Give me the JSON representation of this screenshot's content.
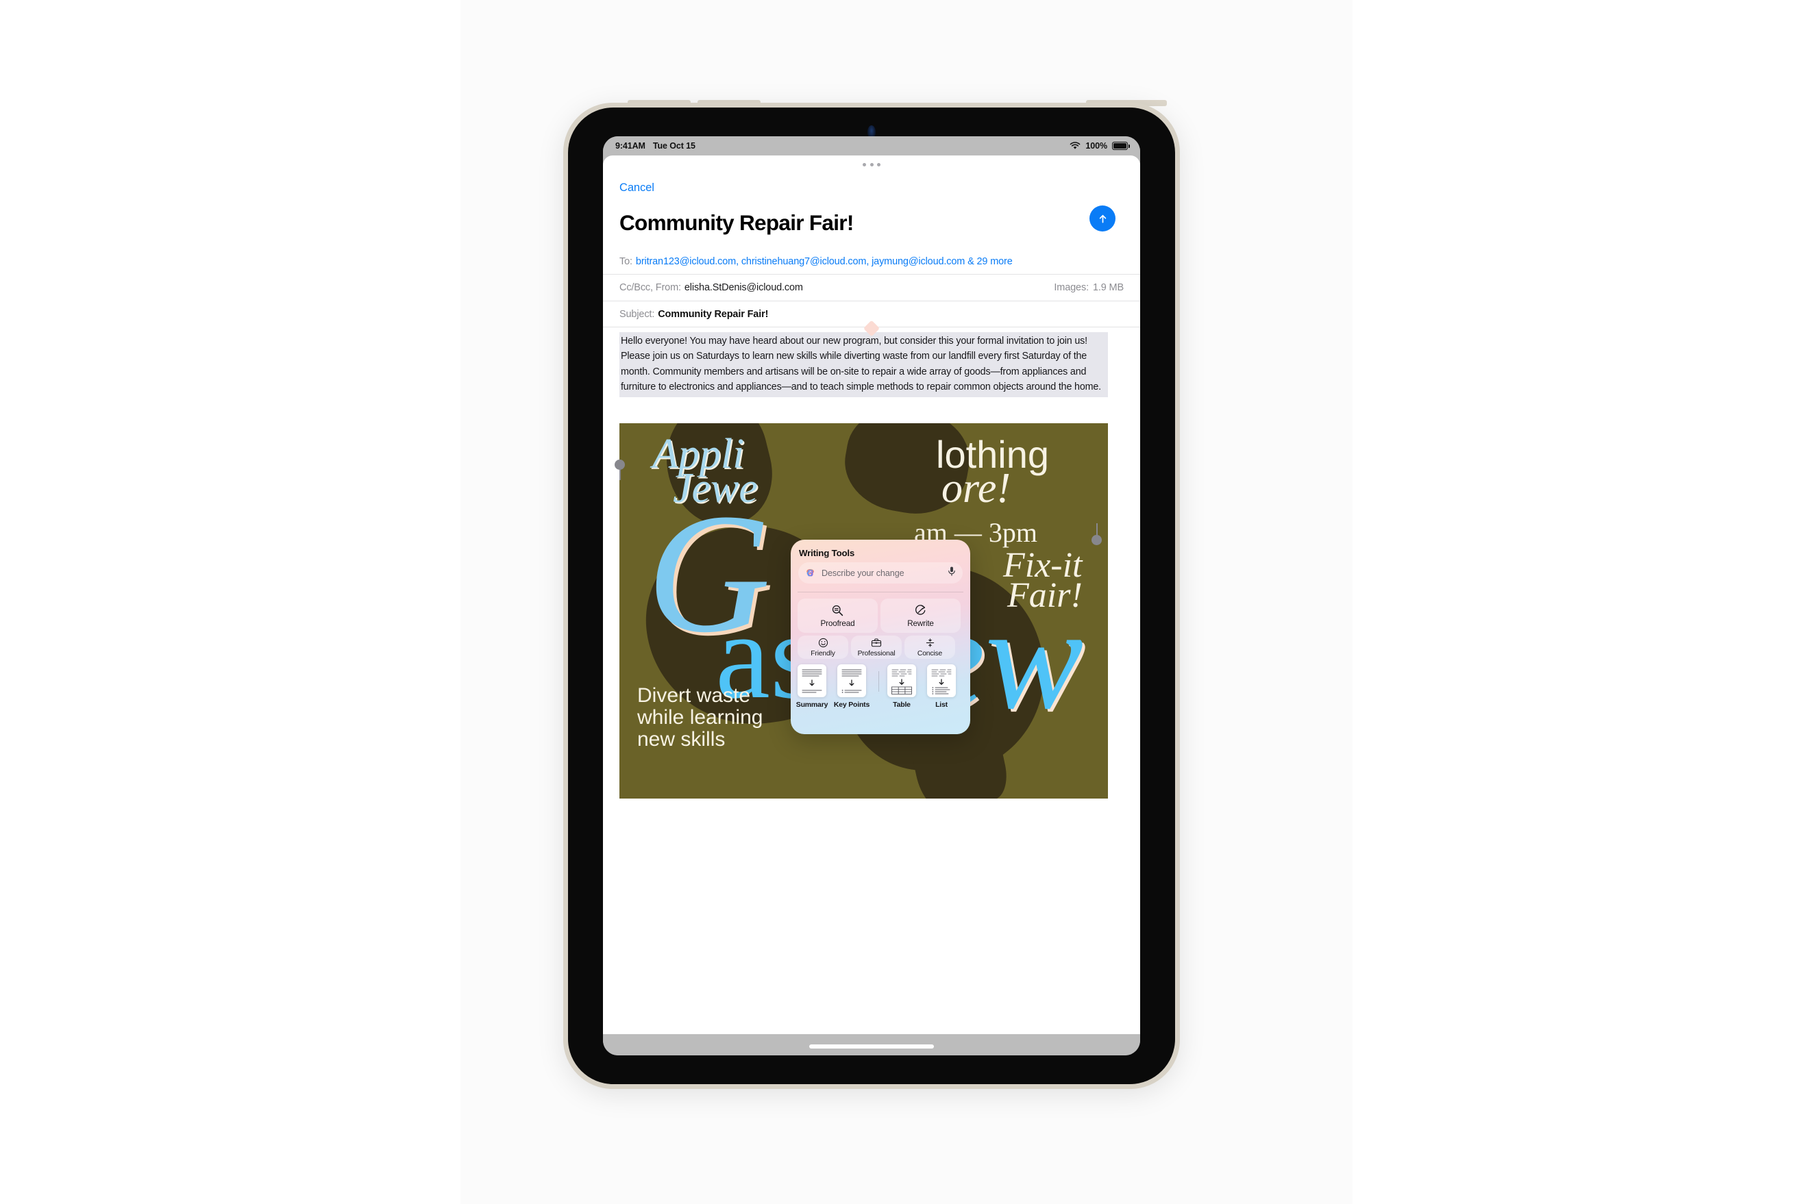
{
  "status_bar": {
    "time": "9:41AM",
    "date": "Tue Oct 15",
    "battery_percent": "100%",
    "wifi_icon": "wifi-icon",
    "battery_icon": "battery-icon"
  },
  "mail": {
    "cancel_label": "Cancel",
    "title": "Community Repair Fair!",
    "send_icon": "arrow-up-icon",
    "grabber_icon": "more-dots-icon",
    "to": {
      "label": "To:",
      "recipients": "britran123@icloud.com, christinehuang7@icloud.com, jaymung@icloud.com & 29 more"
    },
    "cc": {
      "label": "Cc/Bcc, From:",
      "value": "elisha.StDenis@icloud.com",
      "images_label": "Images:",
      "images_size": "1.9 MB"
    },
    "subject": {
      "label": "Subject:",
      "value": "Community Repair Fair!"
    },
    "body": "Hello everyone!\nYou may have heard about our new program, but consider this your formal invitation to join us! Please join us on Saturdays to learn new skills while diverting waste from our landfill every first Saturday of the month. Community members and artisans will be on-site to repair a wide array of goods—from appliances and furniture to electronics and appliances—and to teach simple methods to repair common objects around the home."
  },
  "poster": {
    "background_color": "#6a6228",
    "line_appliances": "Appli",
    "line_jewelry": "Jewe",
    "line_clothing": "lothing",
    "line_more": "ore!",
    "line_hours": "am — 3pm",
    "word_good": "G",
    "word_as": "as",
    "word_new": "New",
    "fixit_line1": "Fix-it",
    "fixit_line2": "Fair!",
    "tagline_1": "Divert waste",
    "tagline_2": "while learning",
    "tagline_3": "new skills"
  },
  "writing_tools": {
    "title": "Writing Tools",
    "describe_placeholder": "Describe your change",
    "apple_intelligence_icon": "apple-intelligence-icon",
    "mic_icon": "microphone-icon",
    "actions": [
      {
        "label": "Proofread",
        "icon": "magnifier-equals-icon"
      },
      {
        "label": "Rewrite",
        "icon": "rewrite-circular-arrow-icon"
      }
    ],
    "tones": [
      {
        "label": "Friendly",
        "icon": "smiley-face-icon"
      },
      {
        "label": "Professional",
        "icon": "briefcase-icon"
      },
      {
        "label": "Concise",
        "icon": "compress-arrows-icon"
      }
    ],
    "formats": [
      {
        "label": "Summary",
        "icon": "document-summary-icon"
      },
      {
        "label": "Key Points",
        "icon": "document-key-points-icon"
      },
      {
        "label": "Table",
        "icon": "document-table-icon"
      },
      {
        "label": "List",
        "icon": "document-list-icon"
      }
    ]
  },
  "colors": {
    "accent_blue": "#0a7cf6",
    "selection_gray": "#e6e6ec",
    "poster_olive": "#6a6228",
    "poster_cyan": "#4fc3f7",
    "poster_cream": "#f2ecd9"
  }
}
